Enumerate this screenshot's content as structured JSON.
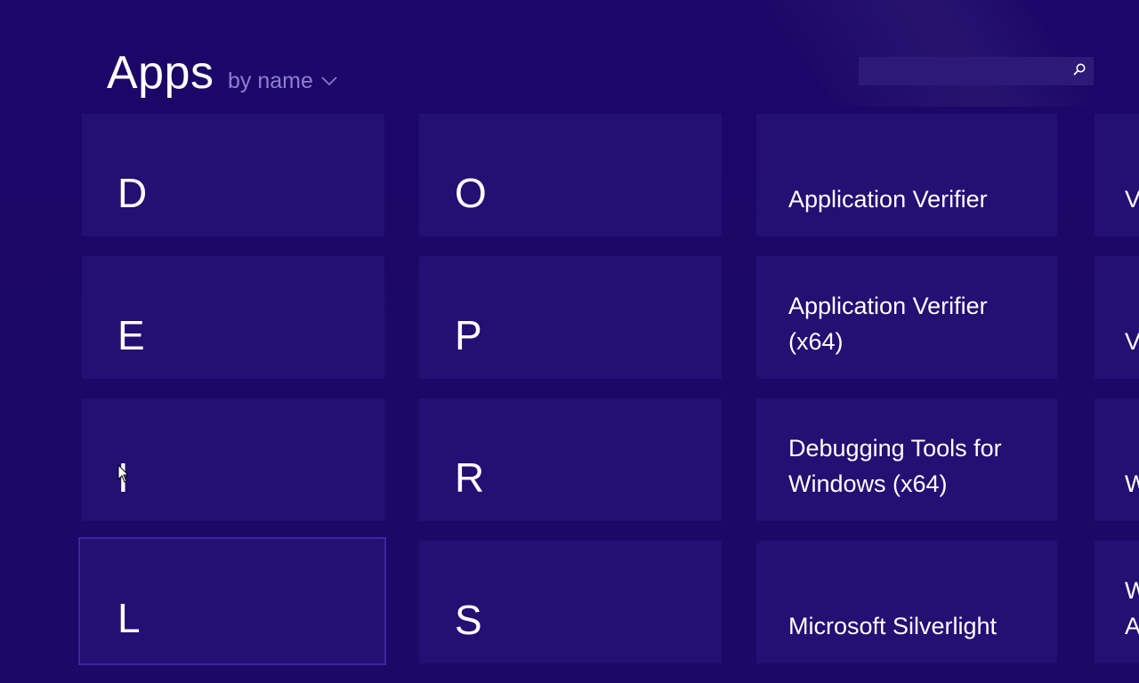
{
  "header": {
    "title": "Apps",
    "sort_label": "by name",
    "sort_icon": "chevron-down-icon"
  },
  "search": {
    "placeholder": "",
    "value": "",
    "icon": "search-icon"
  },
  "groups": [
    {
      "letter": "D"
    },
    {
      "letter": "E"
    },
    {
      "letter": "I"
    },
    {
      "letter": "L"
    },
    {
      "letter": "O"
    },
    {
      "letter": "P"
    },
    {
      "letter": "R"
    },
    {
      "letter": "S"
    }
  ],
  "apps": [
    {
      "name": "Application Verifier"
    },
    {
      "name": "Application Verifier (x64)"
    },
    {
      "name": "Debugging Tools for Windows (x64)"
    },
    {
      "name": "Microsoft Silverlight"
    }
  ],
  "partial_column": [
    {
      "name": "V"
    },
    {
      "name": "V"
    },
    {
      "name": "W"
    },
    {
      "name": "W\nA"
    }
  ],
  "colors": {
    "background": "#1c0768",
    "tile": "#240f73",
    "accent_text": "#8d7fd0"
  }
}
